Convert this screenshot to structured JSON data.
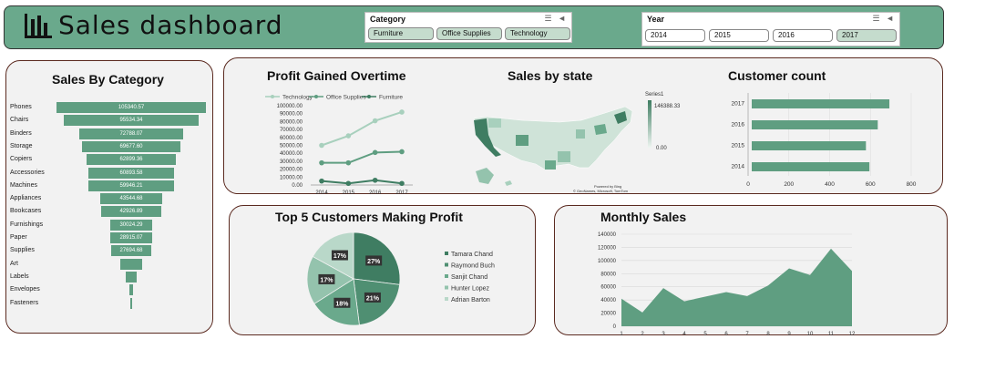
{
  "header": {
    "title": "Sales dashboard",
    "bg_color": "#6aa98c",
    "icon": "bar-chart-icon"
  },
  "category_slicer": {
    "title": "Category",
    "items": [
      "Furniture",
      "Office Supplies",
      "Technology"
    ],
    "selected": [
      "Furniture",
      "Office Supplies",
      "Technology"
    ]
  },
  "year_slicer": {
    "title": "Year",
    "items": [
      "2014",
      "2015",
      "2016",
      "2017"
    ],
    "selected": [
      "2017"
    ]
  },
  "colors": {
    "primary": "#5f9e81",
    "dark": "#3f7d62",
    "light": "#a8d0bd",
    "border": "#5b2a20"
  },
  "sales_by_category": {
    "title": "Sales By Category",
    "chart_data": {
      "type": "bar",
      "orientation": "horizontal-funnel",
      "categories": [
        "Phones",
        "Chairs",
        "Binders",
        "Storage",
        "Copiers",
        "Accessories",
        "Machines",
        "Appliances",
        "Bookcases",
        "Furnishings",
        "Paper",
        "Supplies",
        "Art",
        "Labels",
        "Envelopes",
        "Fasteners"
      ],
      "values": [
        105340.57,
        95534.34,
        72788.07,
        69677.6,
        62899.36,
        60893.58,
        59946.21,
        43544.68,
        42926.89,
        30024.29,
        28915.07,
        27694.68,
        15000,
        7500,
        3000,
        1200
      ],
      "labels": [
        "105340.57",
        "95534.34",
        "72788.07",
        "69677.60",
        "62899.36",
        "60893.58",
        "59946.21",
        "43544.68",
        "42926.89",
        "30024.29",
        "28915.07",
        "27694.68",
        "",
        "",
        "",
        ""
      ]
    }
  },
  "profit_overtime": {
    "title": "Profit Gained Overtime",
    "chart_data": {
      "type": "line",
      "x": [
        "2014",
        "2015",
        "2016",
        "2017"
      ],
      "series": [
        {
          "name": "Technology",
          "values": [
            50000,
            62000,
            81000,
            92000
          ]
        },
        {
          "name": "Office Supplies",
          "values": [
            28000,
            28000,
            41000,
            42000
          ]
        },
        {
          "name": "Furniture",
          "values": [
            5000,
            2000,
            6000,
            2000
          ]
        }
      ],
      "yticks": [
        "0.00",
        "10000.00",
        "20000.00",
        "30000.00",
        "40000.00",
        "50000.00",
        "60000.00",
        "70000.00",
        "80000.00",
        "90000.00",
        "100000.00"
      ],
      "ylim": [
        0,
        100000
      ]
    }
  },
  "sales_by_state": {
    "title": "Sales by state",
    "legend_series": "Series1",
    "legend_max": "146388.33",
    "legend_min": "0.00",
    "attribution": "Powered by Bing",
    "copyright": "© GeoNames, Microsoft, TomTom"
  },
  "customer_count": {
    "title": "Customer count",
    "chart_data": {
      "type": "bar",
      "orientation": "horizontal",
      "categories": [
        "2017",
        "2016",
        "2015",
        "2014"
      ],
      "values": [
        693,
        636,
        578,
        595
      ],
      "xticks": [
        "0",
        "200",
        "400",
        "600",
        "800"
      ],
      "xlim": [
        0,
        800
      ]
    }
  },
  "top_customers": {
    "title": "Top 5 Customers Making Profit",
    "chart_data": {
      "type": "pie",
      "labels": [
        "Tamara Chand",
        "Raymond Buch",
        "Sanjit Chand",
        "Hunter Lopez",
        "Adrian Barton"
      ],
      "values": [
        27,
        21,
        18,
        17,
        17
      ],
      "slice_labels": [
        "27%",
        "21%",
        "18%",
        "17%",
        "17%"
      ],
      "colors": [
        "#3f7d62",
        "#4f8f72",
        "#6aa98c",
        "#94c3ad",
        "#b9d8c9"
      ]
    }
  },
  "monthly_sales": {
    "title": "Monthly Sales",
    "chart_data": {
      "type": "area",
      "x": [
        "1",
        "2",
        "3",
        "4",
        "5",
        "6",
        "7",
        "8",
        "9",
        "10",
        "11",
        "12"
      ],
      "values": [
        42000,
        21000,
        58000,
        38000,
        45000,
        52000,
        46000,
        62000,
        88000,
        78000,
        118000,
        84000
      ],
      "yticks": [
        "0",
        "20000",
        "40000",
        "60000",
        "80000",
        "100000",
        "120000",
        "140000"
      ],
      "ylim": [
        0,
        140000
      ]
    }
  }
}
